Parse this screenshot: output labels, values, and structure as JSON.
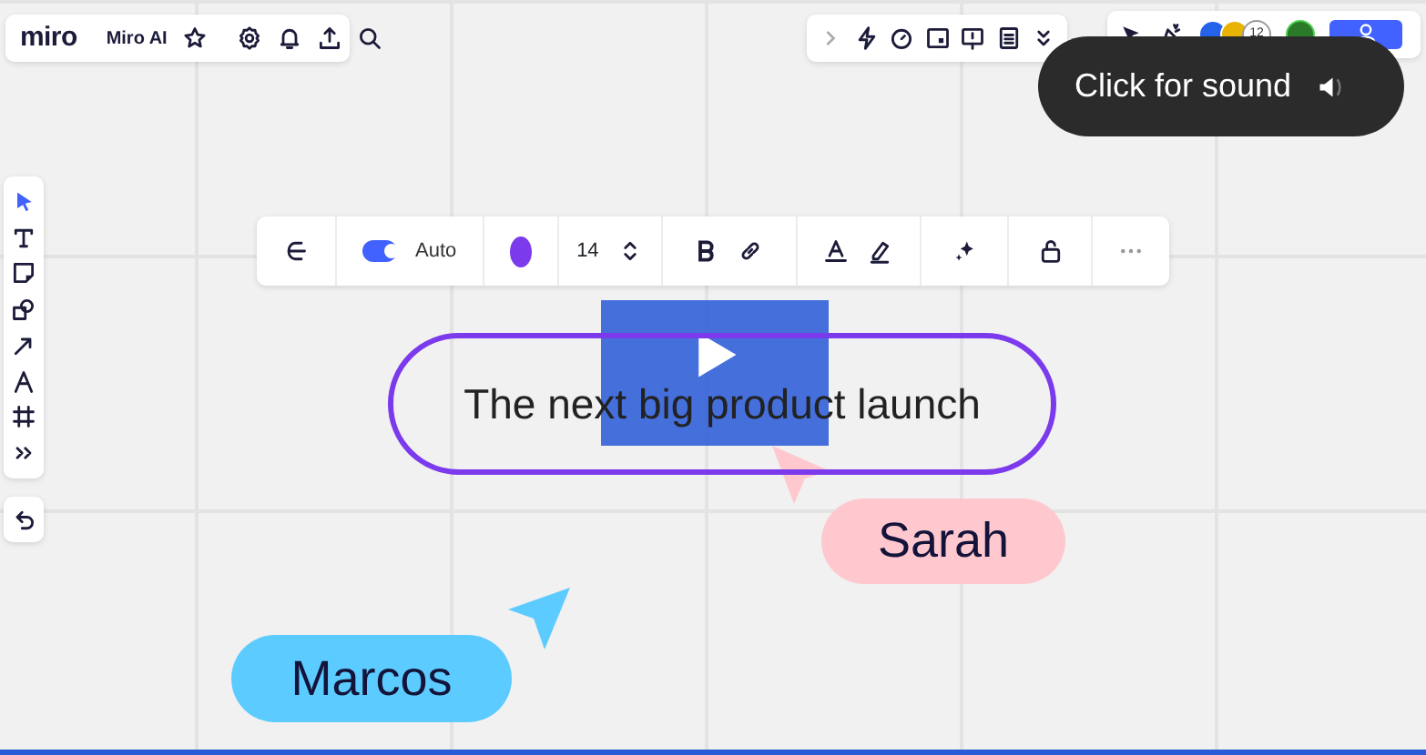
{
  "header": {
    "logo": "miro",
    "board_name": "Miro AI"
  },
  "collaborators": {
    "count": "12"
  },
  "sound_prompt": {
    "text": "Click for sound"
  },
  "tools": [
    {
      "selected": true
    },
    {
      "selected": false
    },
    {
      "selected": false
    },
    {
      "selected": false
    },
    {
      "selected": false
    },
    {
      "selected": false
    },
    {
      "selected": false
    },
    {
      "selected": false
    }
  ],
  "format_toolbar": {
    "auto_toggle": {
      "label": "Auto",
      "on": true
    },
    "color": "#7c3aed",
    "font_size": "14"
  },
  "canvas": {
    "shape_text": "The next big product launch",
    "cursors": [
      {
        "name": "Sarah",
        "color": "#ffc8cf"
      },
      {
        "name": "Marcos",
        "color": "#5ccbff"
      }
    ]
  }
}
